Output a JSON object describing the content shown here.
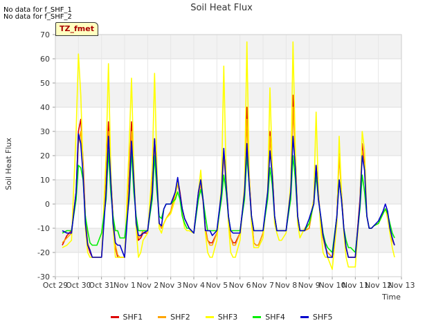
{
  "notices": [
    "No data for f_SHF_1",
    "No data for f_SHF_2"
  ],
  "tz_label": "TZ_fmet",
  "chart_data": {
    "type": "line",
    "title": "Soil Heat Flux",
    "xlabel": "Time",
    "ylabel": "Soil Heat Flux",
    "ylim": [
      -30,
      70
    ],
    "yticks": [
      -30,
      -20,
      -10,
      0,
      10,
      20,
      30,
      40,
      50,
      60,
      70
    ],
    "xlim": [
      0,
      15
    ],
    "xtick_labels": [
      "Oct 29",
      "Oct 30",
      "Oct 31",
      "Nov 1",
      "Nov 2",
      "Nov 3",
      "Nov 4",
      "Nov 5",
      "Nov 6",
      "Nov 7",
      "Nov 8",
      "Nov 9",
      "Nov 10",
      "Nov 11",
      "Nov 12",
      "Nov 13"
    ],
    "grid": true,
    "legend_position": "bottom",
    "x": [
      0.3,
      0.5,
      0.7,
      0.9,
      1.0,
      1.1,
      1.2,
      1.3,
      1.4,
      1.5,
      1.6,
      1.7,
      1.8,
      2.0,
      2.2,
      2.3,
      2.4,
      2.5,
      2.6,
      2.7,
      2.8,
      3.0,
      3.2,
      3.3,
      3.4,
      3.5,
      3.6,
      3.7,
      3.8,
      4.0,
      4.2,
      4.3,
      4.4,
      4.5,
      4.6,
      4.7,
      4.8,
      5.0,
      5.2,
      5.3,
      5.4,
      5.5,
      5.6,
      5.7,
      5.8,
      6.0,
      6.2,
      6.3,
      6.4,
      6.5,
      6.6,
      6.7,
      6.8,
      7.0,
      7.2,
      7.3,
      7.4,
      7.5,
      7.6,
      7.7,
      7.8,
      8.0,
      8.2,
      8.3,
      8.4,
      8.5,
      8.6,
      8.7,
      8.8,
      9.0,
      9.2,
      9.3,
      9.4,
      9.5,
      9.6,
      9.7,
      9.8,
      10.0,
      10.2,
      10.3,
      10.4,
      10.5,
      10.6,
      10.7,
      10.8,
      11.0,
      11.2,
      11.3,
      11.4,
      11.5,
      11.6,
      11.7,
      11.8,
      12.0,
      12.2,
      12.3,
      12.4,
      12.5,
      12.6,
      12.7,
      12.8,
      13.0,
      13.2,
      13.3,
      13.4,
      13.5,
      13.6,
      13.7,
      13.8,
      14.0,
      14.2,
      14.3,
      14.4,
      14.5,
      14.6,
      14.7
    ],
    "series": [
      {
        "name": "SHF1",
        "color": "#dd0000",
        "values": [
          -17,
          -13,
          -11,
          5,
          30,
          35,
          18,
          -5,
          -17,
          -20,
          -22,
          -22,
          -22,
          -22,
          10,
          34,
          12,
          -5,
          -18,
          -22,
          -22,
          -22,
          12,
          34,
          12,
          -8,
          -15,
          -14,
          -12,
          -12,
          10,
          27,
          10,
          -8,
          -10,
          -8,
          -6,
          -3,
          5,
          10,
          5,
          -2,
          -6,
          -8,
          -10,
          -12,
          5,
          10,
          2,
          -10,
          -15,
          -16,
          -16,
          -12,
          5,
          22,
          10,
          -5,
          -14,
          -16,
          -16,
          -12,
          5,
          40,
          12,
          -5,
          -16,
          -17,
          -17,
          -12,
          5,
          30,
          15,
          -5,
          -11,
          -11,
          -11,
          -11,
          5,
          45,
          20,
          -5,
          -11,
          -11,
          -11,
          -10,
          2,
          16,
          5,
          -8,
          -14,
          -18,
          -20,
          -22,
          -5,
          22,
          5,
          -10,
          -18,
          -22,
          -22,
          -22,
          2,
          25,
          15,
          -5,
          -10,
          -10,
          -9,
          -8,
          -4,
          -2,
          -4,
          -10,
          -15,
          -17,
          -15,
          -13
        ]
      },
      {
        "name": "SHF2",
        "color": "#ffa500",
        "values": [
          -16,
          -14,
          -12,
          5,
          25,
          30,
          15,
          -5,
          -16,
          -19,
          -22,
          -22,
          -22,
          -22,
          8,
          30,
          10,
          -5,
          -17,
          -21,
          -22,
          -22,
          10,
          30,
          10,
          -8,
          -14,
          -13,
          -11,
          -11,
          8,
          24,
          8,
          -8,
          -10,
          -8,
          -6,
          -3,
          4,
          8,
          4,
          -2,
          -6,
          -8,
          -10,
          -12,
          4,
          8,
          1,
          -11,
          -15,
          -17,
          -17,
          -12,
          4,
          20,
          8,
          -5,
          -14,
          -17,
          -17,
          -12,
          4,
          35,
          10,
          -5,
          -16,
          -17,
          -17,
          -12,
          4,
          28,
          14,
          -5,
          -11,
          -11,
          -11,
          -11,
          4,
          40,
          18,
          -5,
          -11,
          -11,
          -11,
          -10,
          1,
          14,
          4,
          -8,
          -14,
          -18,
          -20,
          -22,
          -5,
          20,
          4,
          -10,
          -18,
          -22,
          -22,
          -22,
          1,
          22,
          14,
          -5,
          -10,
          -10,
          -9,
          -8,
          -4,
          -2,
          -4,
          -10,
          -15,
          -17,
          -15,
          -13
        ]
      },
      {
        "name": "SHF3",
        "color": "#ffff00",
        "values": [
          -18,
          -17,
          -15,
          30,
          62,
          45,
          15,
          -10,
          -20,
          -22,
          -22,
          -22,
          -22,
          -22,
          20,
          58,
          15,
          -10,
          -22,
          -22,
          -22,
          -22,
          25,
          52,
          15,
          -10,
          -22,
          -20,
          -15,
          -12,
          15,
          54,
          15,
          -10,
          -12,
          -8,
          -6,
          -4,
          2,
          10,
          4,
          -4,
          -10,
          -11,
          -11,
          -12,
          5,
          14,
          2,
          -12,
          -20,
          -22,
          -22,
          -15,
          8,
          57,
          12,
          -8,
          -20,
          -22,
          -22,
          -15,
          8,
          67,
          12,
          -8,
          -18,
          -18,
          -18,
          -14,
          6,
          48,
          16,
          -8,
          -12,
          -15,
          -15,
          -12,
          8,
          67,
          22,
          -8,
          -14,
          -12,
          -10,
          -8,
          2,
          38,
          5,
          -10,
          -20,
          -22,
          -22,
          -27,
          -8,
          28,
          5,
          -12,
          -22,
          -26,
          -26,
          -26,
          0,
          30,
          22,
          -5,
          -10,
          -10,
          -9,
          -8,
          -4,
          -2,
          -6,
          -12,
          -18,
          -22,
          -22,
          -12
        ]
      },
      {
        "name": "SHF4",
        "color": "#00ee00",
        "values": [
          -12,
          -11,
          -11,
          2,
          16,
          15,
          10,
          -5,
          -11,
          -16,
          -17,
          -17,
          -17,
          -12,
          2,
          22,
          5,
          -5,
          -11,
          -11,
          -14,
          -14,
          2,
          22,
          5,
          -5,
          -11,
          -11,
          -11,
          -11,
          2,
          20,
          5,
          -5,
          -6,
          -2,
          0,
          0,
          2,
          5,
          2,
          -5,
          -8,
          -10,
          -10,
          -12,
          2,
          6,
          2,
          -5,
          -11,
          -11,
          -11,
          -11,
          2,
          12,
          5,
          -5,
          -11,
          -11,
          -11,
          -11,
          2,
          20,
          8,
          -5,
          -11,
          -11,
          -11,
          -11,
          2,
          15,
          8,
          -5,
          -11,
          -11,
          -11,
          -11,
          2,
          20,
          10,
          -5,
          -11,
          -11,
          -11,
          -8,
          0,
          12,
          2,
          -5,
          -12,
          -16,
          -18,
          -20,
          -5,
          10,
          2,
          -10,
          -15,
          -18,
          -18,
          -20,
          -2,
          12,
          5,
          -5,
          -10,
          -10,
          -9,
          -8,
          -4,
          -2,
          -4,
          -8,
          -12,
          -14,
          -13,
          -12
        ]
      },
      {
        "name": "SHF5",
        "color": "#0000cc",
        "values": [
          -11,
          -12,
          -12,
          5,
          29,
          25,
          12,
          -8,
          -17,
          -19,
          -22,
          -22,
          -22,
          -22,
          5,
          28,
          10,
          -8,
          -16,
          -17,
          -17,
          -22,
          5,
          26,
          10,
          -8,
          -13,
          -13,
          -12,
          -11,
          5,
          27,
          10,
          -8,
          -9,
          -2,
          0,
          0,
          5,
          11,
          4,
          -2,
          -6,
          -8,
          -10,
          -12,
          5,
          10,
          2,
          -11,
          -11,
          -11,
          -13,
          -11,
          5,
          23,
          8,
          -5,
          -11,
          -12,
          -12,
          -12,
          5,
          25,
          8,
          -5,
          -11,
          -11,
          -11,
          -11,
          5,
          22,
          12,
          -5,
          -11,
          -11,
          -11,
          -11,
          5,
          28,
          15,
          -5,
          -11,
          -11,
          -11,
          -6,
          0,
          16,
          2,
          -5,
          -13,
          -17,
          -22,
          -22,
          -5,
          10,
          2,
          -10,
          -18,
          -22,
          -22,
          -22,
          0,
          20,
          14,
          -5,
          -10,
          -10,
          -9,
          -7,
          -3,
          0,
          -3,
          -10,
          -14,
          -17,
          -14,
          -12
        ]
      }
    ]
  }
}
